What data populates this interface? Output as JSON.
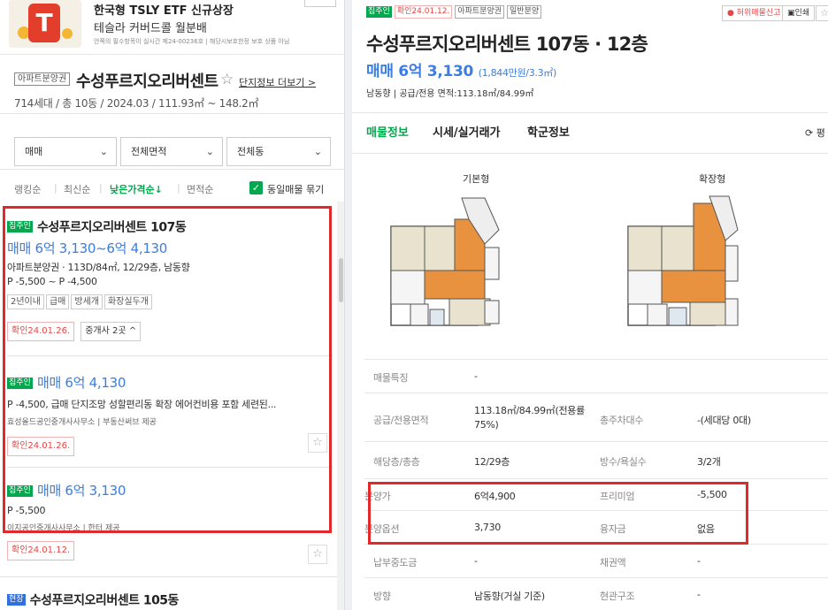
{
  "ad": {
    "title": "한국형 TSLY ETF 신규상장",
    "subtitle": "테슬라 커버드콜 월분배",
    "fine_print": "안쪽의 필수항목이 실시간 제24-00236호 | 해당시보호한정 보호 상품 아님",
    "logo_letter": "T"
  },
  "complex": {
    "type_tag": "아파트분양권",
    "name": "수성푸르지오리버센트",
    "more_link": "단지정보 더보기 >",
    "info": "714세대 / 총 10동 / 2024.03 / 111.93㎡ ~ 148.2㎡"
  },
  "filters": [
    {
      "label": "매매"
    },
    {
      "label": "전체면적"
    },
    {
      "label": "전체동"
    }
  ],
  "sort": {
    "options": [
      "랭킹순",
      "최신순",
      "낮은가격순↓",
      "면적순"
    ],
    "active_index": 2,
    "same_listing_label": "동일매물 묶기",
    "same_listing_checked": true
  },
  "listings": [
    {
      "tag": "집주인",
      "title": "수성푸르지오리버센트 107동",
      "price": "매매 6억 3,130~6억 4,130",
      "detail": "아파트분양권 · 113D/84㎡, 12/29층, 남동향",
      "premium": "P -5,500 ~ P -4,500",
      "chips": [
        "2년이내",
        "급매",
        "방세개",
        "화장실두개"
      ],
      "confirm": "확인24.01.26.",
      "brokers": "중개사 2곳 ^"
    },
    {
      "tag": "집주인",
      "price": "매매 6억 4,130",
      "detail": "P -4,500, 급매 단지조망 성할편리동 확장 에어컨비용 포함 세련된...",
      "agency": "효성올드공인중개사사무소 | 부동산써브 제공",
      "confirm": "확인24.01.26."
    },
    {
      "tag": "집주인",
      "price": "매매 6억 3,130",
      "detail": "P -5,500",
      "agency": "이지공인중개사사무소 | 한터 제공",
      "confirm": "확인24.01.12."
    },
    {
      "tag": "현장",
      "title": "수성푸르지오리버센트 105동"
    }
  ],
  "detail": {
    "tags": [
      "집주인",
      "확인24.01.12.",
      "아파트분양권",
      "일반분양"
    ],
    "report_button": "허위매물신고",
    "print_button": "인쇄",
    "title": "수성푸르지오리버센트 107동 · 12층",
    "price": "매매 6억 3,130",
    "price_per": "(1,844만원/3.3㎡)",
    "desc": "남동향 | 공급/전용 면적:113.18㎡/84.99㎡",
    "tabs": [
      "매물정보",
      "시세/실거래가",
      "학군정보"
    ],
    "refresh_label": "평",
    "floorplans": [
      "기본형",
      "확장형"
    ],
    "table": [
      {
        "k1": "매물특징",
        "v1": "-",
        "k2": "",
        "v2": ""
      },
      {
        "k1": "공급/전용면적",
        "v1": "113.18㎡/84.99㎡(전용률75%)",
        "k2": "총주차대수",
        "v2": "-(세대당 0대)"
      },
      {
        "k1": "해당층/총층",
        "v1": "12/29층",
        "k2": "방수/욕실수",
        "v2": "3/2개"
      },
      {
        "k1": "분양가",
        "v1": "6억4,900",
        "k2": "프리미엄",
        "v2": "-5,500"
      },
      {
        "k1": "분양옵션",
        "v1": "3,730",
        "k2": "융자금",
        "v2": "없음"
      },
      {
        "k1": "납부중도금",
        "v1": "-",
        "k2": "채권액",
        "v2": "-"
      },
      {
        "k1": "방향",
        "v1": "남동향(거실 기준)",
        "k2": "현관구조",
        "v2": "-"
      }
    ]
  },
  "colors": {
    "green": "#03a84e",
    "blue": "#3b7de0",
    "red": "#e3282a"
  }
}
